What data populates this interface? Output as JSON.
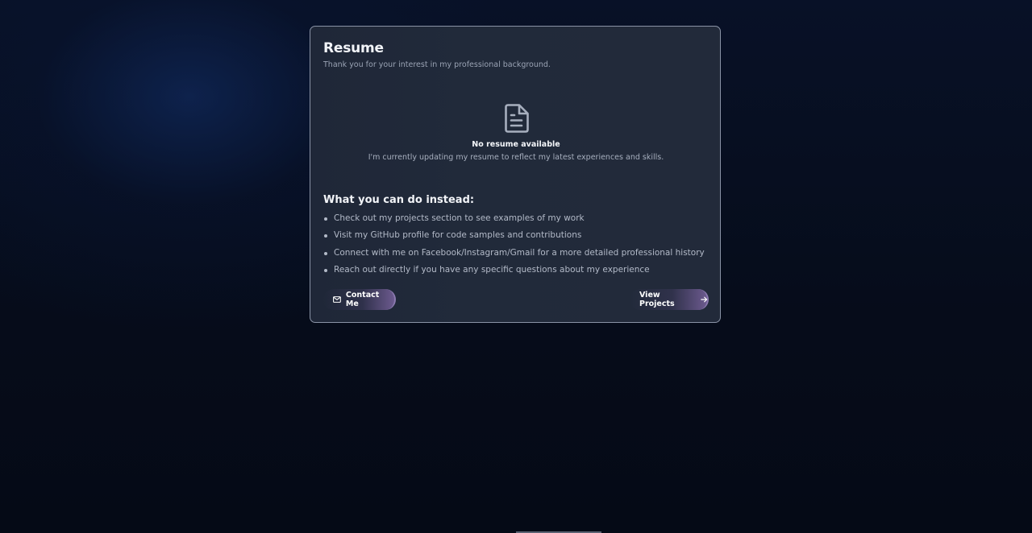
{
  "card": {
    "title": "Resume",
    "subtitle": "Thank you for your interest in my professional background."
  },
  "empty_state": {
    "icon": "file-text-icon",
    "title": "No resume available",
    "description": "I'm currently updating my resume to reflect my latest experiences and skills."
  },
  "alternatives": {
    "heading": "What you can do instead:",
    "items": [
      "Check out my projects section to see examples of my work",
      "Visit my GitHub profile for code samples and contributions",
      "Connect with me on Facebook/Instagram/Gmail for a more detailed professional history",
      "Reach out directly if you have any specific questions about my experience"
    ]
  },
  "actions": {
    "contact_label": "Contact Me",
    "contact_icon": "mail-icon",
    "projects_label": "View Projects",
    "projects_icon": "arrow-right-icon"
  },
  "colors": {
    "background": "#060c1a",
    "card": "#212a3a",
    "card_border": "#8a93a6",
    "button_accent": "#6c5a8e"
  }
}
